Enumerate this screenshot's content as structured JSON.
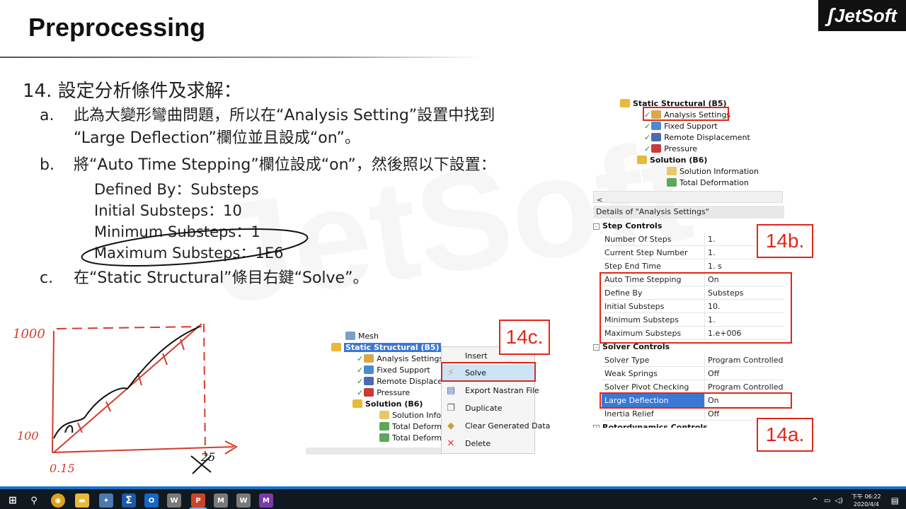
{
  "slide": {
    "title": "Preprocessing",
    "logo": "JetSoft",
    "watermark": "JetSoft",
    "step_number": "14.",
    "step_title": "設定分析條件及求解：",
    "items": [
      {
        "label": "a.",
        "lines": [
          "此為大變形彎曲問題，所以在“Analysis Setting”設置中找到",
          "“Large Deflection”欄位並且設成“on”。"
        ]
      },
      {
        "label": "b.",
        "lines": [
          "將“Auto Time Stepping”欄位設成“on”，然後照以下設置："
        ]
      },
      {
        "label": "c.",
        "lines": [
          "在“Static Structural”條目右鍵“Solve”。"
        ]
      }
    ],
    "settings": [
      "Defined By：Substeps",
      "Initial Substeps：10",
      "Minimum Substeps：1",
      "Maximum Substeps：1E6"
    ],
    "callouts": {
      "a": "14a.",
      "b": "14b.",
      "c": "14c."
    }
  },
  "tree_top": {
    "nodes": [
      {
        "label": "Static Structural (B5)",
        "bold": true
      },
      {
        "label": "Analysis Settings",
        "boxed": true
      },
      {
        "label": "Fixed Support"
      },
      {
        "label": "Remote Displacement"
      },
      {
        "label": "Pressure"
      },
      {
        "label": "Solution (B6)",
        "bold": true
      },
      {
        "label": "Solution Information"
      },
      {
        "label": "Total Deformation"
      }
    ]
  },
  "details": {
    "header": "Details of \"Analysis Settings\"",
    "scroll_arrow": "<",
    "groups": [
      {
        "name": "Step Controls",
        "toggle": "-",
        "rows": [
          {
            "key": "Number Of Steps",
            "value": "1."
          },
          {
            "key": "Current Step Number",
            "value": "1."
          },
          {
            "key": "Step End Time",
            "value": "1. s"
          },
          {
            "key": "Auto Time Stepping",
            "value": "On"
          },
          {
            "key": "Define By",
            "value": "Substeps"
          },
          {
            "key": "Initial Substeps",
            "value": "10."
          },
          {
            "key": "Minimum Substeps",
            "value": "1."
          },
          {
            "key": "Maximum Substeps",
            "value": "1.e+006"
          }
        ]
      },
      {
        "name": "Solver Controls",
        "toggle": "-",
        "rows": [
          {
            "key": "Solver Type",
            "value": "Program Controlled"
          },
          {
            "key": "Weak Springs",
            "value": "Off"
          },
          {
            "key": "Solver Pivot Checking",
            "value": "Program Controlled"
          },
          {
            "key": "Large Deflection",
            "value": "On"
          },
          {
            "key": "Inertia Relief",
            "value": "Off"
          }
        ]
      },
      {
        "name": "Rotordynamics Controls",
        "toggle": "+"
      }
    ]
  },
  "tree_bottom": {
    "nodes": [
      {
        "label": "Mesh"
      },
      {
        "label": "Static Structural (B5)",
        "selected": true
      },
      {
        "label": "Analysis Settings"
      },
      {
        "label": "Fixed Support"
      },
      {
        "label": "Remote Displacem"
      },
      {
        "label": "Pressure"
      },
      {
        "label": "Solution (B6)",
        "bold": true
      },
      {
        "label": "Solution Info"
      },
      {
        "label": "Total Deform"
      },
      {
        "label": "Total Deform"
      }
    ]
  },
  "context_menu": {
    "items": [
      {
        "label": "Insert",
        "icon": ""
      },
      {
        "label": "Solve",
        "icon": "solve-icon",
        "glyph": "⚡",
        "highlighted": true
      },
      {
        "label": "Export Nastran File",
        "icon": "export-icon",
        "glyph": "▤"
      },
      {
        "label": "Duplicate",
        "icon": "duplicate-icon",
        "glyph": "❐"
      },
      {
        "label": "Clear Generated Data",
        "icon": "clear-icon",
        "glyph": "◆"
      },
      {
        "label": "Delete",
        "icon": "delete-icon",
        "glyph": "✕"
      }
    ]
  },
  "sketch": {
    "labels": {
      "y_top": "1000",
      "y_bottom": "100",
      "x_left": "0.15",
      "x_right": "25"
    }
  },
  "taskbar": {
    "apps": [
      {
        "name": "windows-start",
        "glyph": "⊞",
        "color": "#101820"
      },
      {
        "name": "search",
        "glyph": "⚲",
        "color": "#101820"
      },
      {
        "name": "chrome",
        "glyph": "◉",
        "color": "#d8a21e"
      },
      {
        "name": "file-explorer",
        "glyph": "▬",
        "color": "#e8b93a"
      },
      {
        "name": "app-bird",
        "glyph": "✦",
        "color": "#4a7ab0"
      },
      {
        "name": "sigma-app",
        "glyph": "Σ",
        "color": "#1a5aa8"
      },
      {
        "name": "outlook",
        "glyph": "O",
        "color": "#1467c8"
      },
      {
        "name": "workbench",
        "glyph": "W",
        "color": "#7a7a7a"
      },
      {
        "name": "powerpoint",
        "glyph": "P",
        "color": "#c9452a",
        "active": true
      },
      {
        "name": "mechanical",
        "glyph": "M",
        "color": "#7a7a7a"
      },
      {
        "name": "workbench-2",
        "glyph": "W",
        "color": "#7a7a7a"
      },
      {
        "name": "app-m",
        "glyph": "M",
        "color": "#7a3aa8"
      }
    ],
    "tray": {
      "chevron": "^",
      "clock_time": "下午 06:22",
      "clock_date": "2020/4/4"
    }
  }
}
